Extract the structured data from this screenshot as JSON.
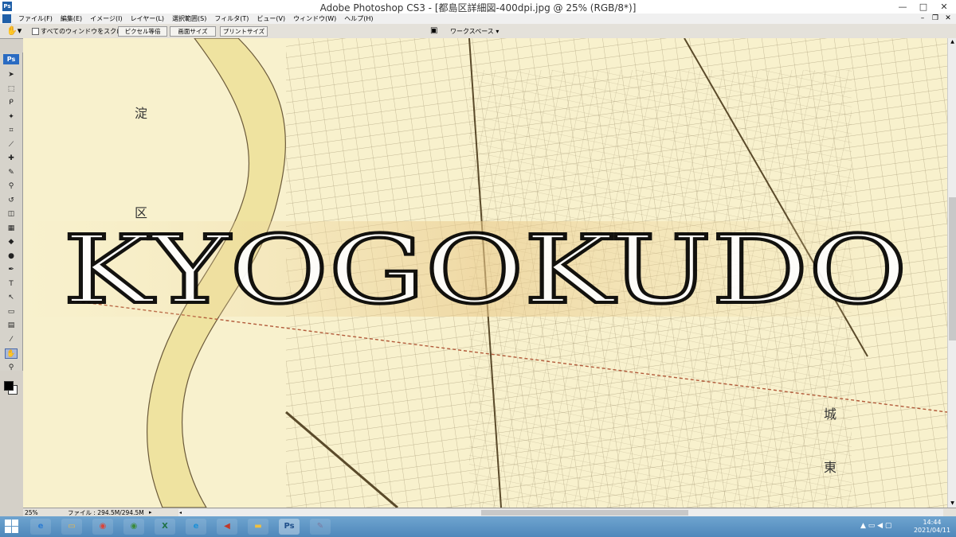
{
  "window": {
    "app_icon": "Ps",
    "title": "Adobe Photoshop CS3 - [都島区詳細図-400dpi.jpg @ 25% (RGB/8*)]",
    "controls": {
      "minimize": "—",
      "maximize": "□",
      "close": "✕"
    }
  },
  "menubar": {
    "items": [
      "ファイル(F)",
      "編集(E)",
      "イメージ(I)",
      "レイヤー(L)",
      "選択範囲(S)",
      "フィルタ(T)",
      "ビュー(V)",
      "ウィンドウ(W)",
      "ヘルプ(H)"
    ],
    "doc_controls": {
      "minimize": "–",
      "restore": "❐",
      "close": "✕"
    }
  },
  "options_bar": {
    "tool_icon": "hand-icon",
    "checkbox_label": "すべてのウィンドウをスクロール",
    "buttons": [
      "ピクセル等倍",
      "画面サイズ",
      "プリントサイズ"
    ],
    "workspace_label": "ワークスペース ▾"
  },
  "toolbox": {
    "logo": "Ps",
    "tools": [
      {
        "name": "move-tool-icon",
        "glyph": "➤"
      },
      {
        "name": "marquee-tool-icon",
        "glyph": "⬚"
      },
      {
        "name": "lasso-tool-icon",
        "glyph": "ᑭ"
      },
      {
        "name": "magic-wand-tool-icon",
        "glyph": "✦"
      },
      {
        "name": "crop-tool-icon",
        "glyph": "⌗"
      },
      {
        "name": "slice-tool-icon",
        "glyph": "⟋"
      },
      {
        "name": "healing-brush-tool-icon",
        "glyph": "✚"
      },
      {
        "name": "brush-tool-icon",
        "glyph": "✎"
      },
      {
        "name": "clone-stamp-tool-icon",
        "glyph": "⚲"
      },
      {
        "name": "history-brush-tool-icon",
        "glyph": "↺"
      },
      {
        "name": "eraser-tool-icon",
        "glyph": "◫"
      },
      {
        "name": "gradient-tool-icon",
        "glyph": "▦"
      },
      {
        "name": "blur-tool-icon",
        "glyph": "◆"
      },
      {
        "name": "dodge-tool-icon",
        "glyph": "●"
      },
      {
        "name": "pen-tool-icon",
        "glyph": "✒"
      },
      {
        "name": "type-tool-icon",
        "glyph": "T"
      },
      {
        "name": "path-selection-tool-icon",
        "glyph": "↖"
      },
      {
        "name": "shape-tool-icon",
        "glyph": "▭"
      },
      {
        "name": "notes-tool-icon",
        "glyph": "▤"
      },
      {
        "name": "eyedropper-tool-icon",
        "glyph": "⁄"
      },
      {
        "name": "hand-tool-icon",
        "glyph": "✋"
      },
      {
        "name": "zoom-tool-icon",
        "glyph": "⚲"
      }
    ],
    "active_tool_index": 20
  },
  "canvas": {
    "watermark": "KYOGOKUDO",
    "map_labels": [
      "淀",
      "区",
      "城",
      "東"
    ]
  },
  "statusbar": {
    "zoom": "25%",
    "file_info": "ファイル : 294.5M/294.5M",
    "arrow": "▸",
    "scroll_left": "◂"
  },
  "taskbar": {
    "apps": [
      {
        "name": "ie-icon",
        "label": "e",
        "color": "#2b7cd3"
      },
      {
        "name": "file-explorer-icon",
        "label": "▭",
        "color": "#e8b84a"
      },
      {
        "name": "chrome-icon",
        "label": "◉",
        "color": "#d9453b"
      },
      {
        "name": "chrome-profile-icon",
        "label": "◉",
        "color": "#3a8a3a"
      },
      {
        "name": "excel-icon",
        "label": "X",
        "color": "#1e7145"
      },
      {
        "name": "edge-icon",
        "label": "e",
        "color": "#1e90d6"
      },
      {
        "name": "volume-app-icon",
        "label": "◀",
        "color": "#c0392b"
      },
      {
        "name": "folder-icon",
        "label": "▬",
        "color": "#f0c040"
      },
      {
        "name": "photoshop-icon",
        "label": "Ps",
        "color": "#1f4f8a"
      },
      {
        "name": "paint-icon",
        "label": "✎",
        "color": "#7a7aa0"
      }
    ],
    "active_app_index": 8,
    "tray": "▲ ▭ ◀ ▢",
    "time": "14:44",
    "date": "2021/04/11"
  }
}
